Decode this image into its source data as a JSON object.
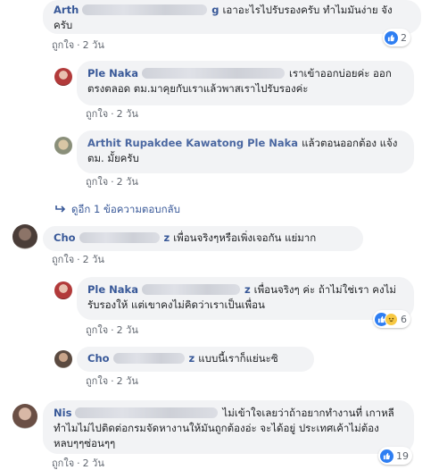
{
  "comments": [
    {
      "name": "Arth",
      "name_tail": "g",
      "text": "เอาอะไรไปรับรองครับ ทำไมมันง่าย จังครับ",
      "like_label": "ถูกใจ",
      "time": "2 วัน",
      "reaction_count": "2"
    },
    {
      "name": "Ple Naka",
      "text": "เราเข้าออกบ่อยค่ะ ออกตรงตลอด ตม.มาคุยกับเราแล้วพาสเราไปรับรองค่ะ",
      "like_label": "ถูกใจ",
      "time": "2 วัน"
    },
    {
      "name": "Arthit Rupakdee Kawatong Ple Naka",
      "text": "แล้วตอนออกต้อง แจ้ง ตม. มั้ยครับ",
      "like_label": "ถูกใจ",
      "time": "2 วัน"
    },
    {
      "name": "Cho",
      "name_tail": "z",
      "text": "เพื่อนจริงๆหรือเพิ่งเจอกัน แย่มาก",
      "like_label": "ถูกใจ",
      "time": "2 วัน"
    },
    {
      "name": "Ple Naka",
      "name_tail": "z",
      "text": "เพื่อนจริงๆ ค่ะ ถ้าไม่ใช่เรา คงไม่รับรองให้ แต่เขาคงไม่คิดว่าเราเป็นเพื่อน",
      "like_label": "ถูกใจ",
      "time": "2 วัน",
      "reaction_count": "6"
    },
    {
      "name": "Cho",
      "name_tail": "z",
      "text": "แบบนี้เราก็แย่นะซิ",
      "like_label": "ถูกใจ",
      "time": "2 วัน"
    },
    {
      "name": "Nis",
      "text": "ไม่เข้าใจเลยว่าถ้าอยากทำงานที่ เกาหลีทำไมไม่ไปติดต่อกรมจัดหางานให้มันถูกต้องอ่ะ จะได้อยู่ ประเทศเค้าไม่ต้องหลบๆๆซ่อนๆๆ",
      "like_label": "ถูกใจ",
      "time": "2 วัน",
      "reaction_count": "19"
    }
  ],
  "more_replies": "ดูอีก 1 ข้อความตอบกลับ",
  "colors": {
    "name": "#385898",
    "bubble": "#f2f3f5",
    "meta": "#616770",
    "like_badge": "#2e7ef2"
  },
  "icons": [
    "like-icon",
    "haha-icon",
    "reply-arrow-icon"
  ]
}
